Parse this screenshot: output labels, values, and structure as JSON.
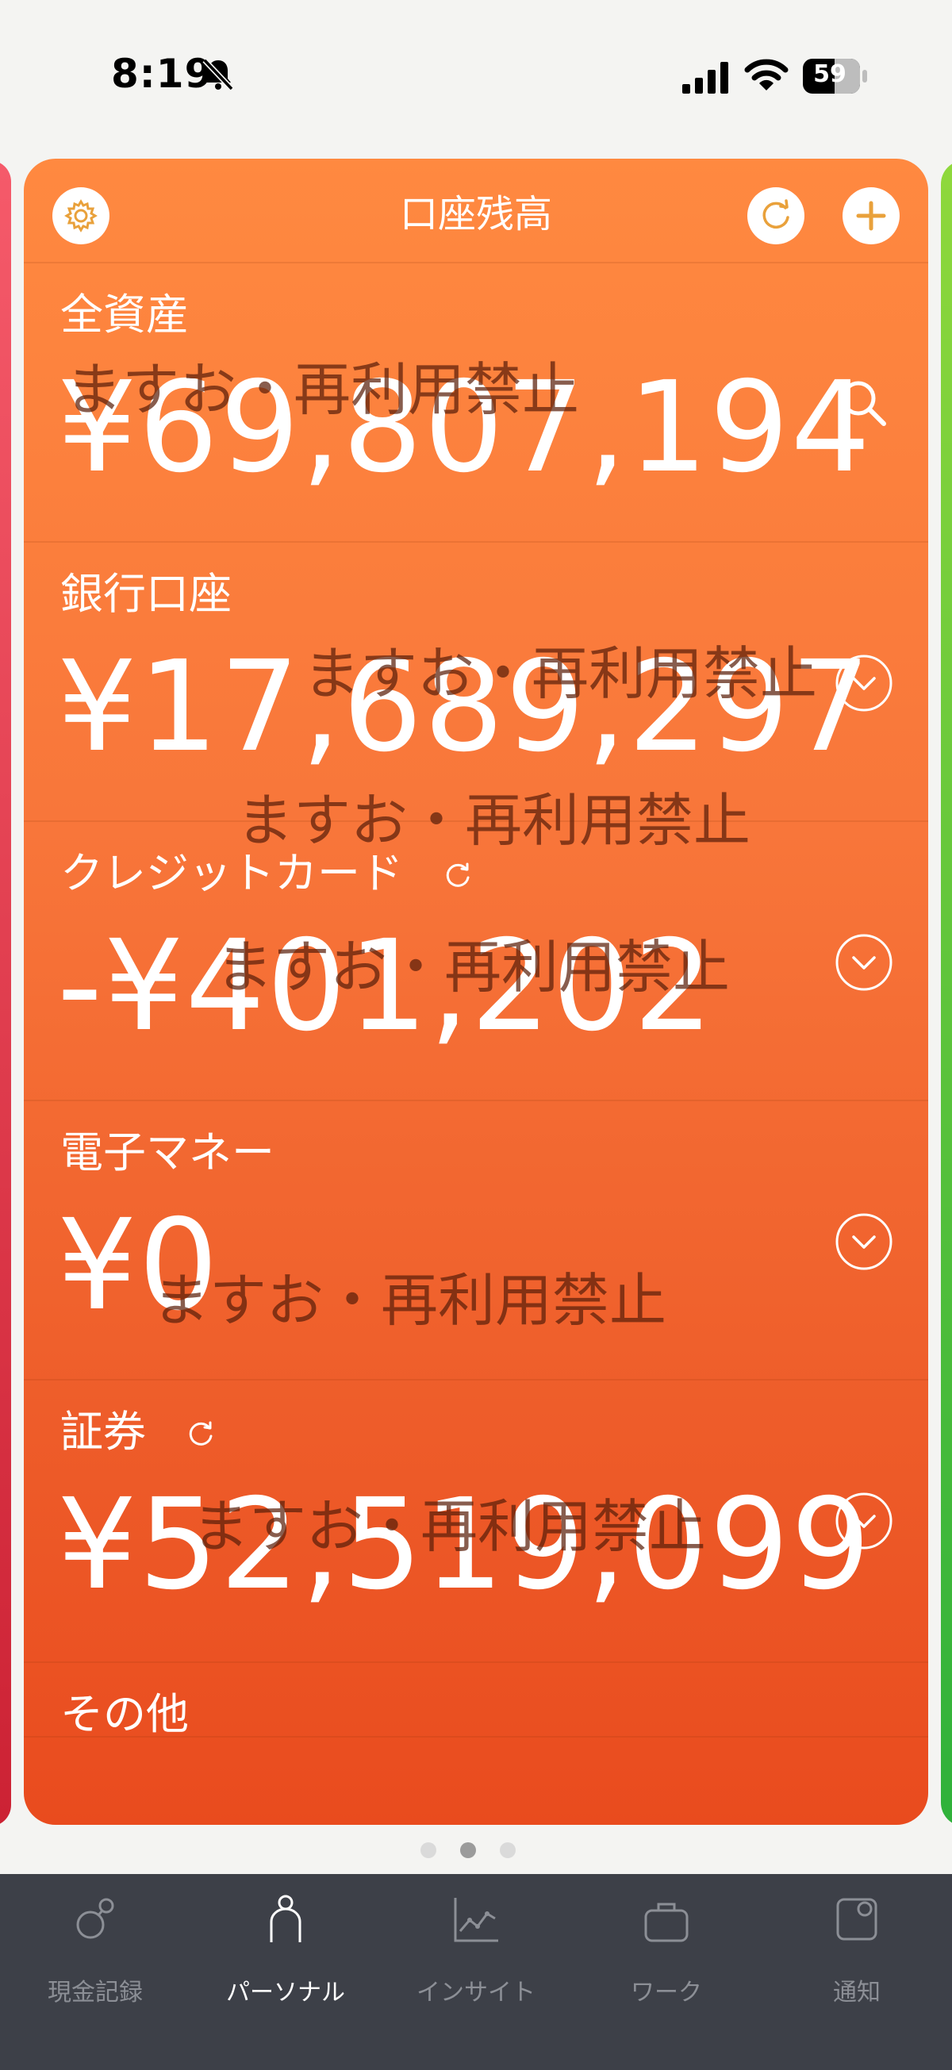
{
  "status_bar": {
    "time": "8:19",
    "battery": "59"
  },
  "header": {
    "title": "口座残高"
  },
  "sections": [
    {
      "label": "全資産",
      "amount": "¥69,807,194"
    },
    {
      "label": "銀行口座",
      "amount": "¥17,689,297"
    },
    {
      "label": "クレジットカード",
      "amount": "-¥401,202"
    },
    {
      "label": "電子マネー",
      "amount": "¥0"
    },
    {
      "label": "証券",
      "amount": "¥52,519,099"
    },
    {
      "label": "その他"
    }
  ],
  "watermark": "ますお・再利用禁止",
  "pager": {
    "count": 3,
    "active": 1
  },
  "tabs": [
    {
      "label": "現金記録",
      "icon": "cash-record-icon"
    },
    {
      "label": "パーソナル",
      "icon": "person-icon",
      "active": true
    },
    {
      "label": "インサイト",
      "icon": "chart-icon"
    },
    {
      "label": "ワーク",
      "icon": "briefcase-icon"
    },
    {
      "label": "通知",
      "icon": "notification-icon"
    }
  ],
  "colors": {
    "card_top": "#ff8940",
    "card_bottom": "#e94b1e",
    "tab_bar": "#3d4048",
    "accent_icon": "#e9a13b"
  }
}
